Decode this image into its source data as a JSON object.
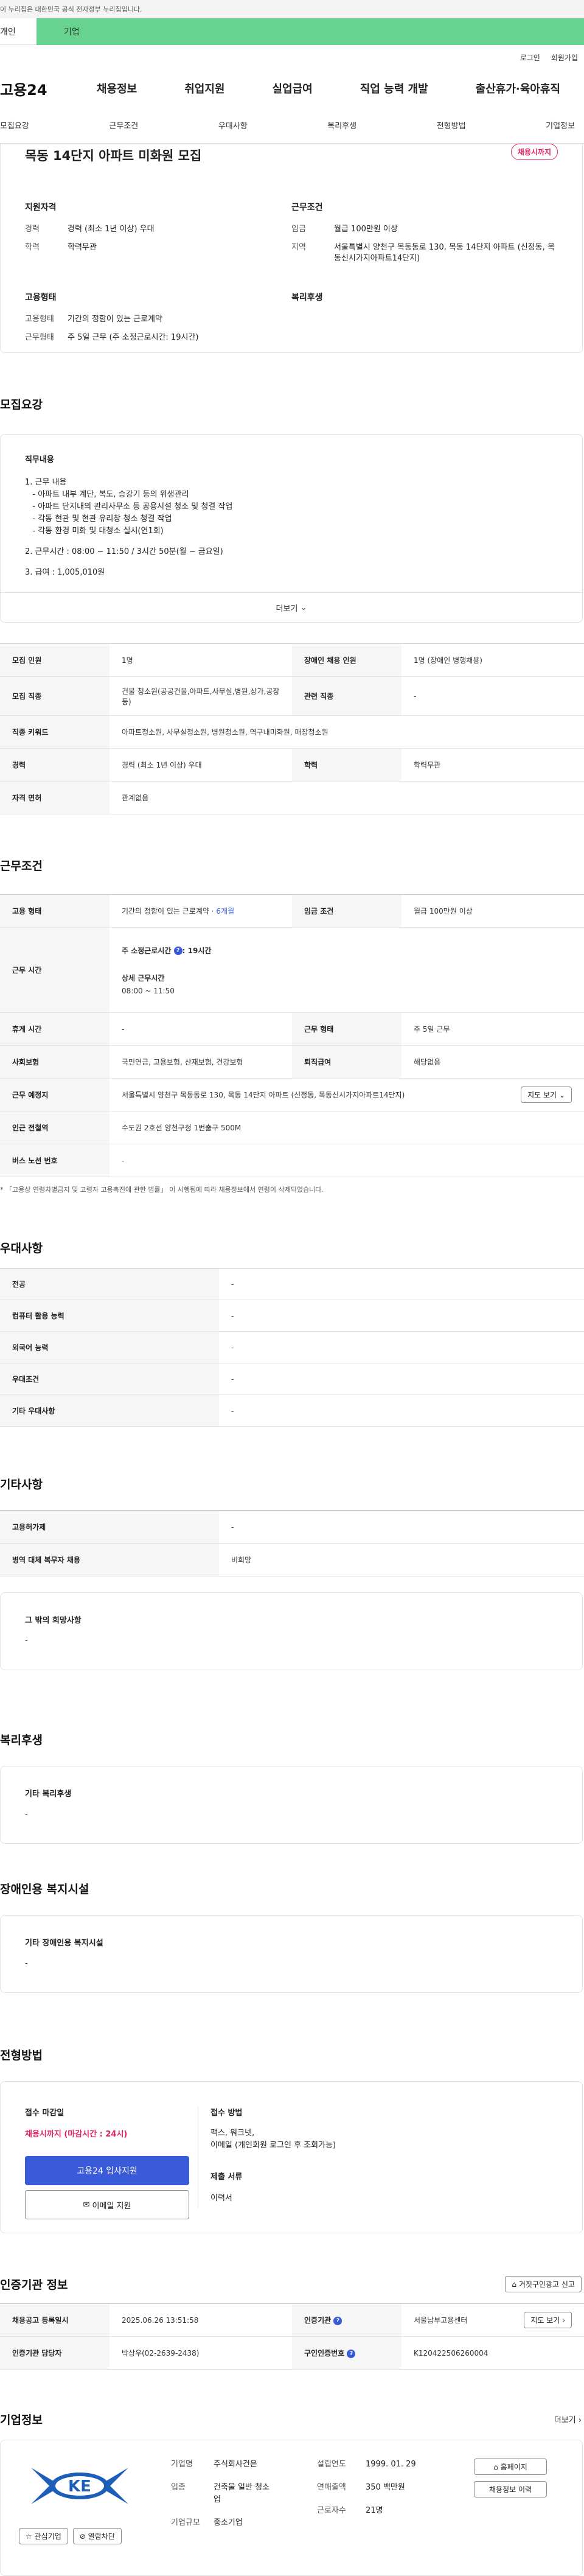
{
  "gov_banner": "이 누리집은 대한민국 공식 전자정부 누리집입니다.",
  "top_tabs": [
    "개인",
    "기업"
  ],
  "util": [
    "로그인",
    "회원가입"
  ],
  "logo": "고용24",
  "gnb": [
    "채용정보",
    "취업지원",
    "실업급여",
    "직업 능력 개발",
    "출산휴가·육아휴직"
  ],
  "subnav": [
    "모집요강",
    "근무조건",
    "우대사항",
    "복리후생",
    "전형방법",
    "기업정보"
  ],
  "summary": {
    "title": "목동 14단지 아파트 미화원 모집",
    "badge": "채용시까지",
    "qual_title": "지원자격",
    "career_k": "경력",
    "career_v": "경력 (최소 1년 이상) 우대",
    "edu_k": "학력",
    "edu_v": "학력무관",
    "cond_title": "근무조건",
    "wage_k": "임금",
    "wage_v": "월급 100만원 이상",
    "area_k": "지역",
    "area_v": "서울특별시 양천구 목동동로 130, 목동 14단지 아파트 (신정동, 목동신시가지아파트14단지)",
    "emp_title": "고용형태",
    "emptype_k": "고용형태",
    "emptype_v": "기간의 정함이 있는 근로계약",
    "worktype_k": "근무형태",
    "worktype_v": "주 5일 근무 (주 소정근로시간: 19시간)",
    "welfare_title": "복리후생"
  },
  "recruit": {
    "title": "모집요강",
    "duty_title": "직무내용",
    "lines": [
      "1. 근무 내용",
      "   - 아파트 내부 계단, 복도, 승강기 등의 위생관리",
      "   - 아파트 단지내의 관리사무소 등 공용시설 청소 및 청결 작업",
      "   - 각동 현관 및 현관 유리창 청소 청결 작업",
      "   - 각동 환경 미화 및 대청소 실시(연1회)",
      "",
      "2. 근무시간 : 08:00 ~ 11:50 / 3시간 50분(월 ~ 금요일)",
      "",
      "3. 급여 : 1,005,010원"
    ],
    "more": "더보기"
  },
  "recruit_table": {
    "headcount_k": "모집 인원",
    "headcount_v": "1명",
    "disabled_k": "장애인 채용 인원",
    "disabled_v": "1명 (장애인 병행채용)",
    "job_k": "모집 직종",
    "job_v": "건물 청소원(공공건물,아파트,사무실,병원,상가,공장 등)",
    "related_k": "관련 직종",
    "related_v": "-",
    "keyword_k": "직종 키워드",
    "keyword_v": "아파트청소원, 사무실청소원, 병원청소원, 역구내미화원, 매장청소원",
    "career_k": "경력",
    "career_v": "경력 (최소 1년 이상) 우대",
    "edu_k": "학력",
    "edu_v": "학력무관",
    "license_k": "자격 면허",
    "license_v": "관계없음"
  },
  "conditions": {
    "title": "근무조건",
    "emptype_k": "고용 형태",
    "emptype_v": "기간의 정함이 있는 근로계약",
    "emptype_period": "6개월",
    "wage_k": "임금 조건",
    "wage_v": "월급 100만원 이상",
    "hours_k": "근무 시간",
    "hours_week_label": "주 소정근로시간",
    "hours_week_v": ": 19시간",
    "hours_detail_label": "상세 근무시간",
    "hours_detail_v": "08:00 ~ 11:50",
    "break_k": "휴게 시간",
    "break_v": "-",
    "worktype_k": "근무 형태",
    "worktype_v": "주 5일 근무",
    "insurance_k": "사회보험",
    "insurance_v": "국민연금, 고용보험, 산재보험, 건강보험",
    "severance_k": "퇴직급여",
    "severance_v": "해당없음",
    "place_k": "근무 예정지",
    "place_v": "서울특별시 양천구 목동동로 130, 목동 14단지 아파트 (신정동, 목동신시가지아파트14단지)",
    "map_btn": "지도 보기",
    "subway_k": "인근 전철역",
    "subway_v": "수도권 2호선 양천구청 1번출구 500M",
    "bus_k": "버스 노선 번호",
    "bus_v": "-",
    "note": "* 「고용상 연령차별금지 및 고령자 고용촉진에 관한 법률」 이 시행됨에 따라 채용정보에서 연령이 삭제되었습니다."
  },
  "preference": {
    "title": "우대사항",
    "rows": [
      {
        "k": "전공",
        "v": "-"
      },
      {
        "k": "컴퓨터 활용 능력",
        "v": "-"
      },
      {
        "k": "외국어 능력",
        "v": "-"
      },
      {
        "k": "우대조건",
        "v": "-"
      },
      {
        "k": "기타 우대사항",
        "v": "-"
      }
    ]
  },
  "etc": {
    "title": "기타사항",
    "rows": [
      {
        "k": "고용허가제",
        "v": "-"
      },
      {
        "k": "병역 대체 복무자 채용",
        "v": "비희망"
      }
    ],
    "other_title": "그 밖의 희망사항",
    "other_v": "-"
  },
  "welfare": {
    "title": "복리후생",
    "box_title": "기타 복리후생",
    "box_v": "-"
  },
  "disabled_fac": {
    "title": "장애인용 복지시설",
    "box_title": "기타 장애인용 복지시설",
    "box_v": "-"
  },
  "process": {
    "title": "전형방법",
    "deadline_title": "접수 마감일",
    "deadline_v": "채용시까지 (마감시간 : 24시)",
    "btn_apply": "고용24 입사지원",
    "btn_email": "이메일 지원",
    "method_title": "접수 방법",
    "method_v1": "팩스, 워크넷,",
    "method_v2": "이메일 (개인회원 로그인 후 조회가능)",
    "docs_title": "제출 서류",
    "docs_v": "이력서"
  },
  "cert": {
    "title": "인증기관 정보",
    "report_btn": "거짓구인광고 신고",
    "regdate_k": "채용공고 등록일시",
    "regdate_v": "2025.06.26 13:51:58",
    "agency_k": "인증기관",
    "agency_v": "서울남부고용센터",
    "map_btn": "지도 보기",
    "manager_k": "인증기관 담당자",
    "manager_v": "박상우(02-2639-2438)",
    "certno_k": "구인인증번호",
    "certno_v": "K120422506260004"
  },
  "company": {
    "title": "기업정보",
    "more": "더보기",
    "logo_text": "KE",
    "fav_btn": "관심기업",
    "block_btn": "열람차단",
    "name_k": "기업명",
    "name_v": "주식회사건은",
    "industry_k": "업종",
    "industry_v1": "건축물 일반 청소",
    "industry_v2": "업",
    "size_k": "기업규모",
    "size_v": "중소기업",
    "founded_k": "설립연도",
    "founded_v": "1999. 01. 29",
    "revenue_k": "연매출액",
    "revenue_v": "350 백만원",
    "employees_k": "근로자수",
    "employees_v": "21명",
    "home_btn": "홈페이지",
    "jobs_btn": "채용정보 이력"
  },
  "colors": {
    "accent": "#3a5bd9",
    "badge": "#e0245e",
    "tab_green": "#68d391"
  }
}
